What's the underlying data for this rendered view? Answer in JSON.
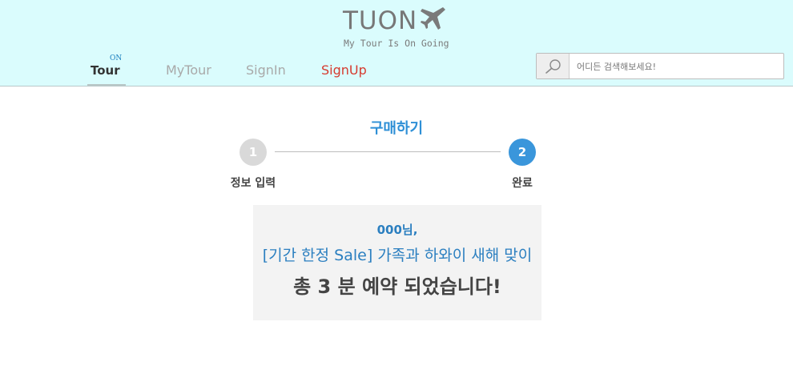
{
  "header": {
    "logo_text": "TUON",
    "tagline": "My Tour Is On Going",
    "bg_color": "#dafcfd"
  },
  "nav": {
    "tour_badge": "ON",
    "tour_label": "Tour",
    "mytour_label": "MyTour",
    "signin_label": "SignIn",
    "signup_label": "SignUp",
    "signup_color": "#d63b2f"
  },
  "search": {
    "placeholder": "어디든 검색해보세요!",
    "icon": "search-icon"
  },
  "checkout": {
    "title": "구매하기",
    "steps": [
      {
        "number": "1",
        "label": "정보 입력",
        "active": false
      },
      {
        "number": "2",
        "label": "완료",
        "active": true
      }
    ],
    "accent_color": "#3a96db"
  },
  "result": {
    "user": "000님,",
    "product": "[기간 한정 Sale] 가족과 하와이 새해 맞이",
    "message": "총 3 분 예약 되었습니다!"
  }
}
